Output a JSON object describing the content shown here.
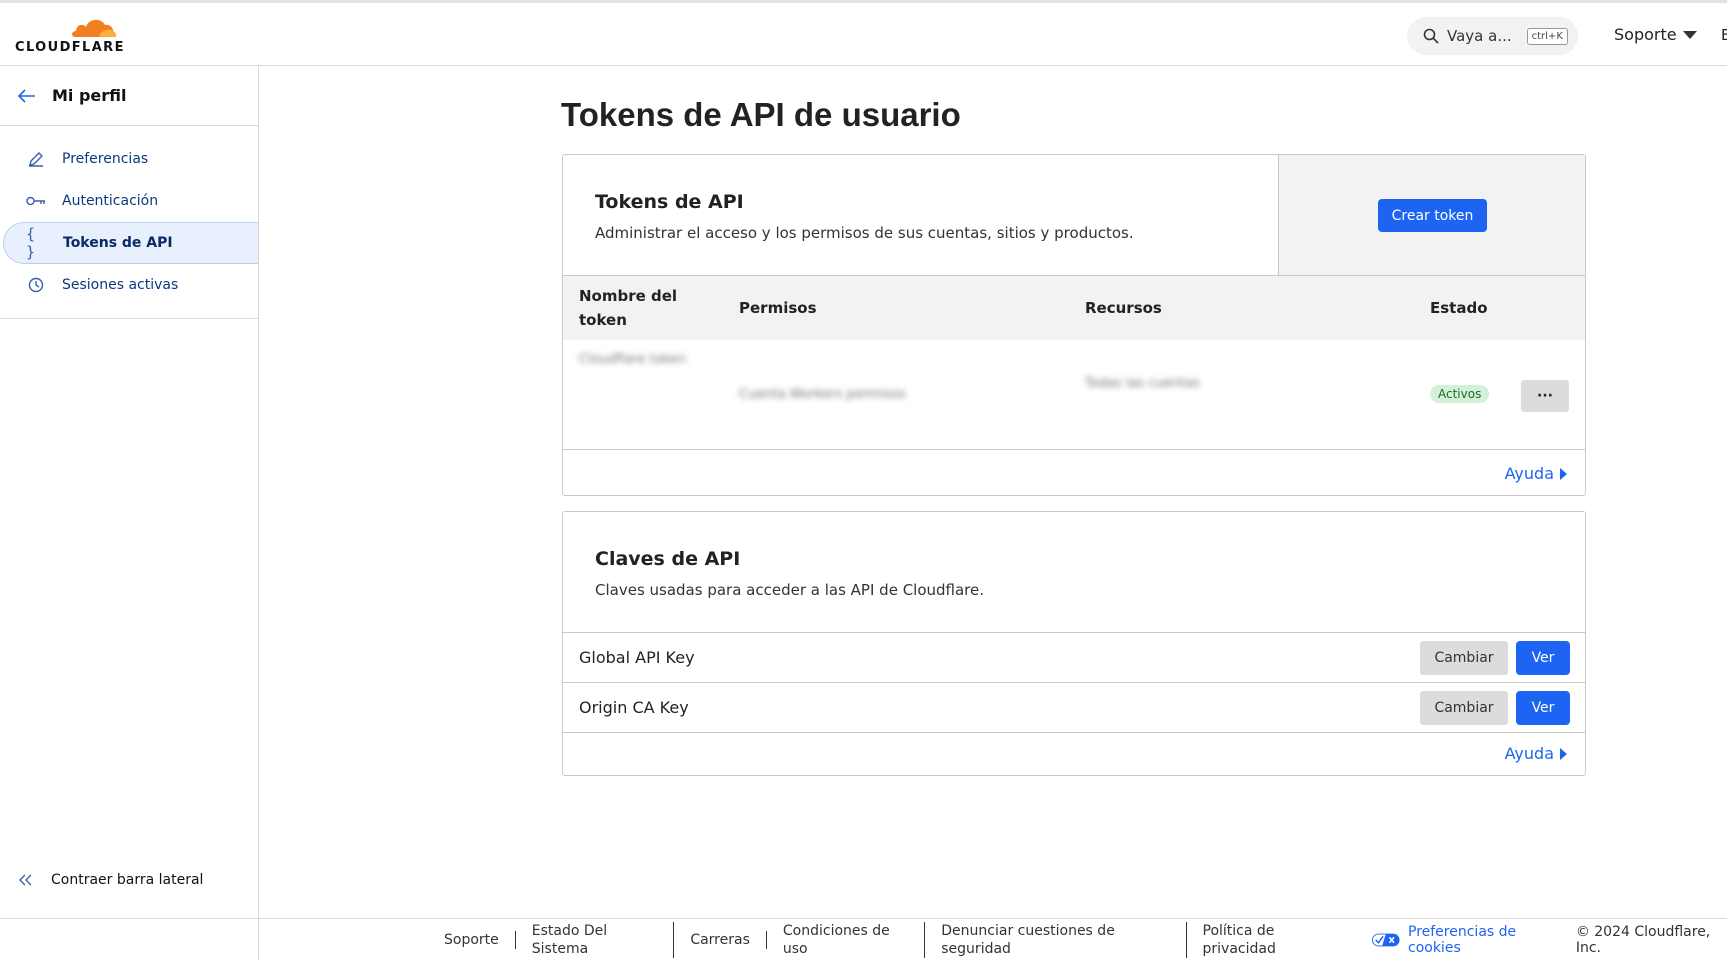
{
  "header": {
    "logo_text": "CLOUDFLARE",
    "search_placeholder": "Vaya a...",
    "search_shortcut": "ctrl+K",
    "support_label": "Soporte",
    "cut_label": "E"
  },
  "sidebar": {
    "back_title": "Mi perfil",
    "items": [
      {
        "label": "Preferencias",
        "icon": "pencil-icon"
      },
      {
        "label": "Autenticación",
        "icon": "key-icon"
      },
      {
        "label": "Tokens de API",
        "icon": "braces-icon",
        "active": true
      },
      {
        "label": "Sesiones activas",
        "icon": "clock-icon"
      }
    ],
    "collapse_label": "Contraer barra lateral"
  },
  "main": {
    "page_title": "Tokens de API de usuario",
    "tokens_card": {
      "title": "Tokens de API",
      "description": "Administrar el acceso y los permisos de sus cuentas, sitios y productos.",
      "create_button": "Crear token",
      "columns": [
        "Nombre del token",
        "Permisos",
        "Recursos",
        "Estado"
      ],
      "rows": [
        {
          "name": "Cloudflare token",
          "permissions": "Cuenta.Workers permisos",
          "resources": "Todas las cuentas",
          "status": "Activos",
          "more_label": "···"
        }
      ],
      "help_label": "Ayuda"
    },
    "keys_card": {
      "title": "Claves de API",
      "description": "Claves usadas para acceder a las API de Cloudflare.",
      "keys": [
        {
          "name": "Global API Key",
          "change_label": "Cambiar",
          "view_label": "Ver"
        },
        {
          "name": "Origin CA Key",
          "change_label": "Cambiar",
          "view_label": "Ver"
        }
      ],
      "help_label": "Ayuda"
    }
  },
  "footer": {
    "links": [
      "Soporte",
      "Estado Del Sistema",
      "Carreras",
      "Condiciones de uso",
      "Denunciar cuestiones de seguridad",
      "Política de privacidad"
    ],
    "cookie_label": "Preferencias de cookies",
    "copyright": "© 2024 Cloudflare, Inc."
  },
  "colors": {
    "accent": "#1d64f2",
    "brand_orange": "#f38020",
    "active_badge_bg": "#d3f1d8"
  }
}
